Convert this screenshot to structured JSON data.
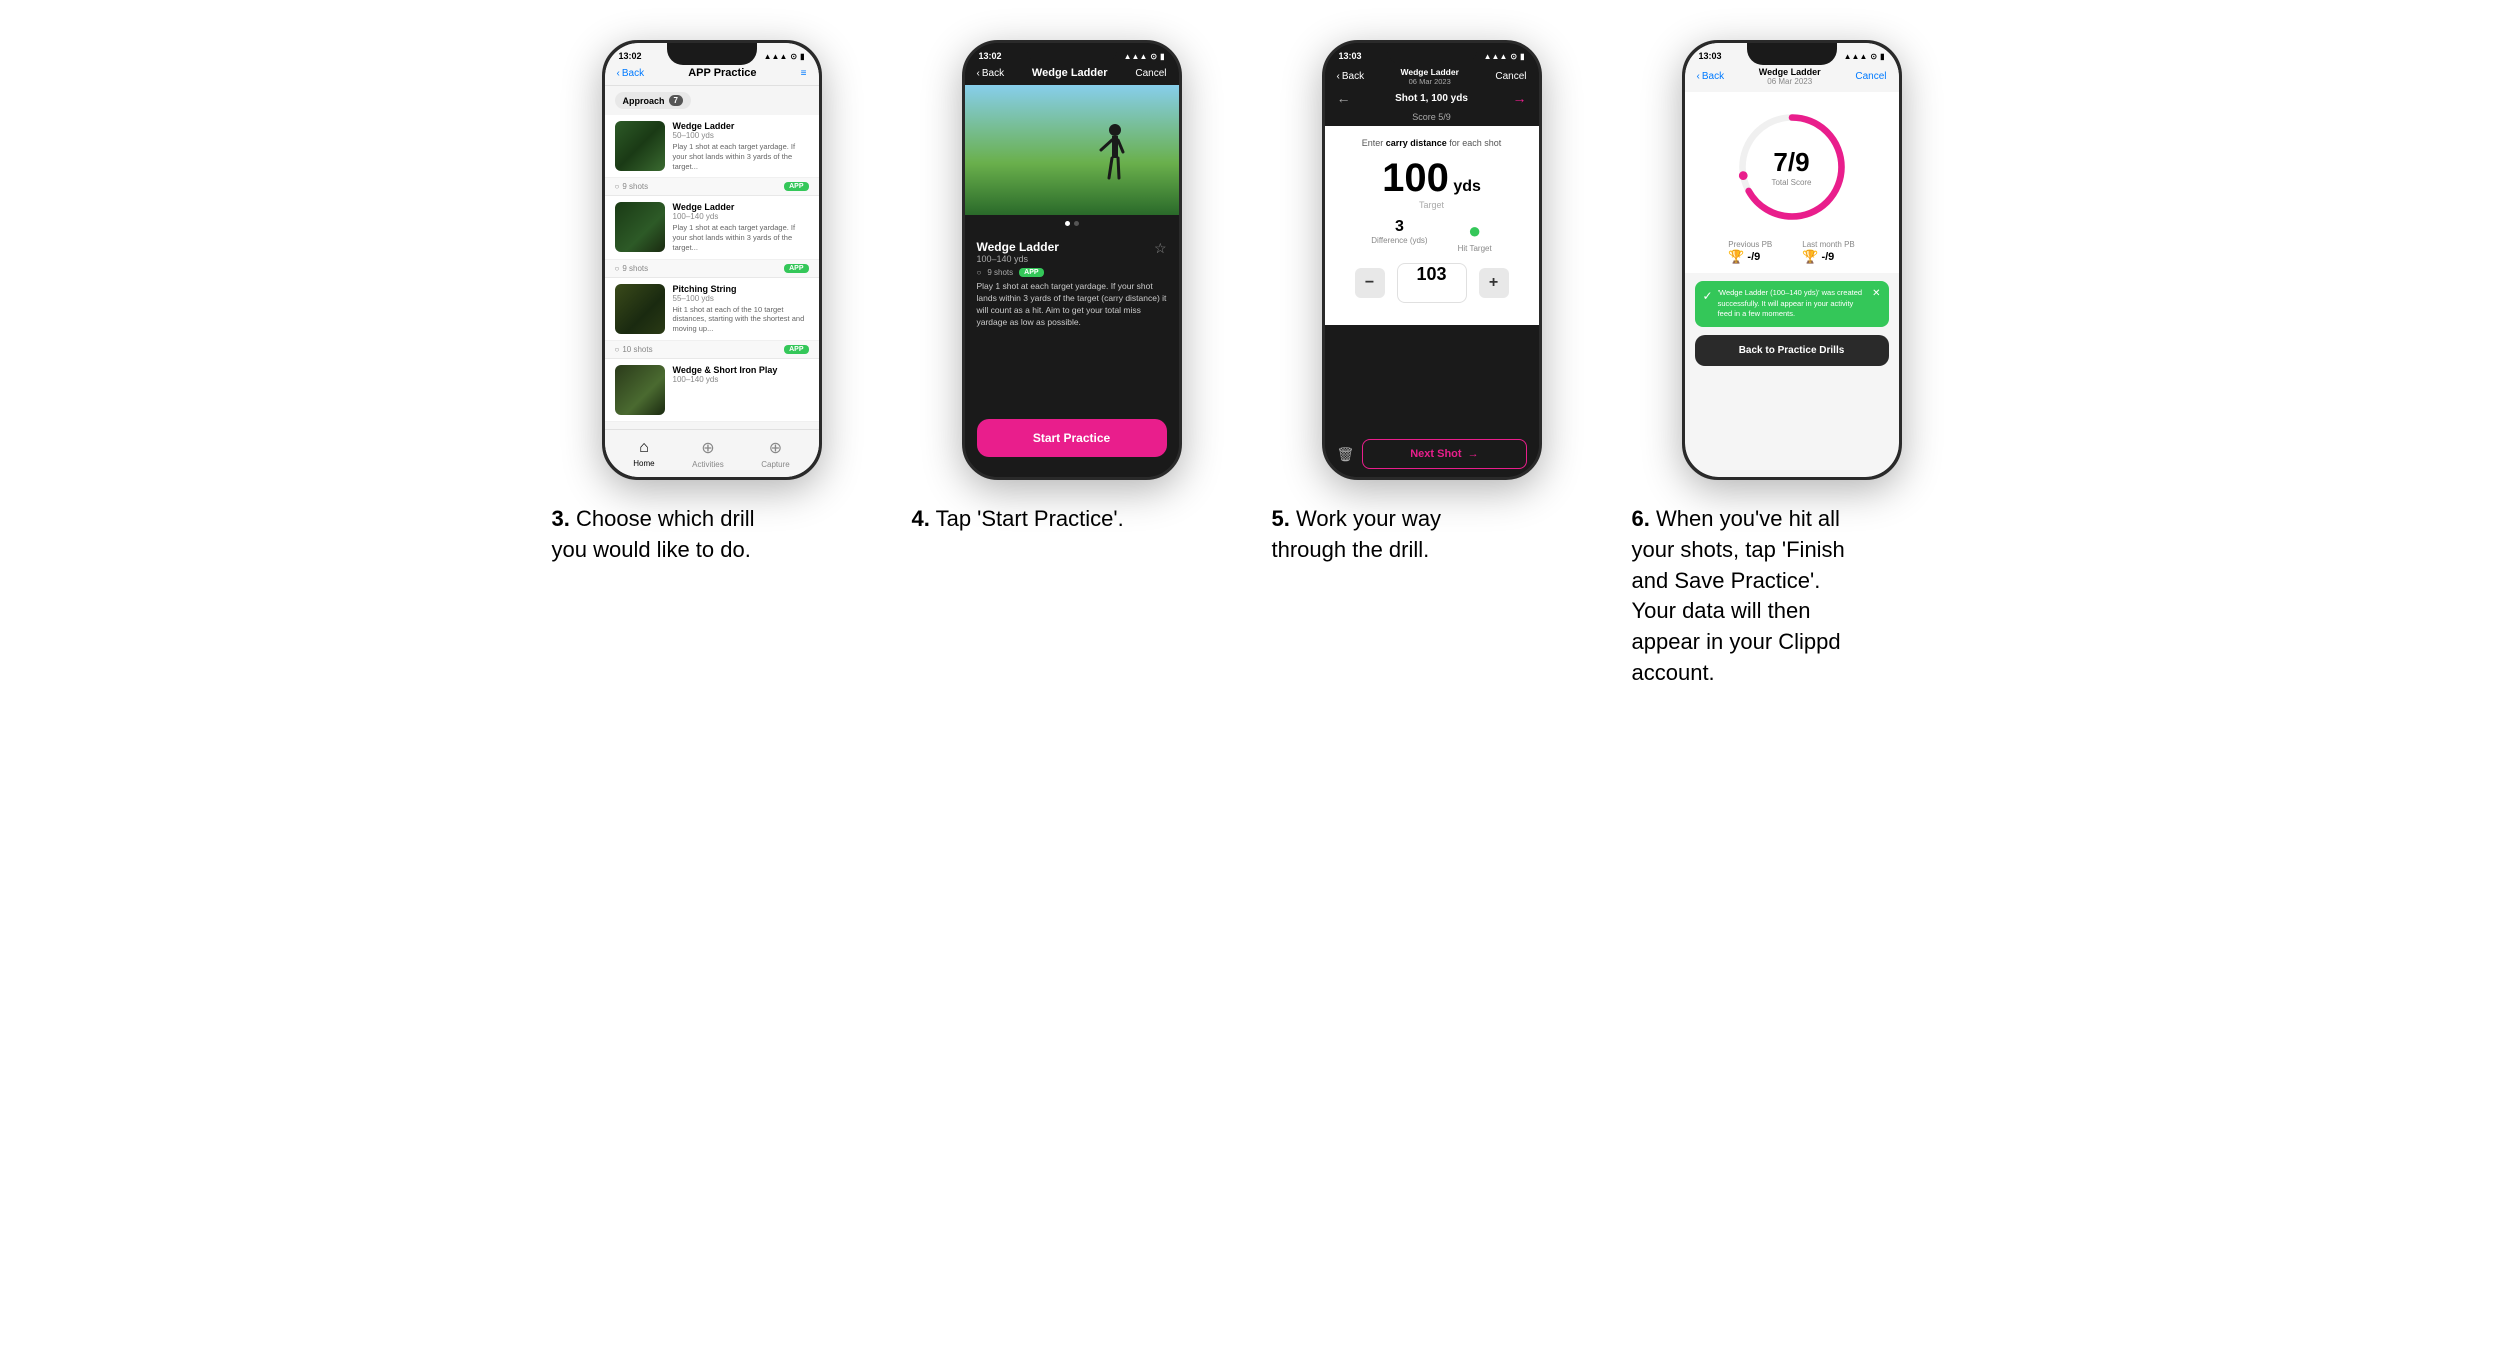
{
  "steps": [
    {
      "number": "3",
      "description": "Choose which drill you would like to do.",
      "phone": {
        "time": "13:02",
        "nav": {
          "back": "Back",
          "title": "APP Practice",
          "action": "≡"
        },
        "category": "Approach",
        "category_count": "7",
        "drills": [
          {
            "name": "Wedge Ladder",
            "range": "50–100 yds",
            "desc": "Play 1 shot at each target yardage. If your shot lands within 3 yards of the target...",
            "shots": "9 shots",
            "badge": "APP"
          },
          {
            "name": "Wedge Ladder",
            "range": "100–140 yds",
            "desc": "Play 1 shot at each target yardage. If your shot lands within 3 yards of the target...",
            "shots": "9 shots",
            "badge": "APP"
          },
          {
            "name": "Pitching String",
            "range": "55–100 yds",
            "desc": "Hit 1 shot at each of the 10 target distances, starting with the shortest and moving up...",
            "shots": "10 shots",
            "badge": "APP"
          },
          {
            "name": "Wedge & Short Iron Play",
            "range": "100–140 yds",
            "desc": "",
            "shots": "",
            "badge": ""
          }
        ],
        "bottom_nav": [
          "Home",
          "Activities",
          "Capture"
        ]
      }
    },
    {
      "number": "4",
      "description": "Tap 'Start Practice'.",
      "phone": {
        "time": "13:02",
        "nav": {
          "back": "Back",
          "title": "Wedge Ladder",
          "action": "Cancel"
        },
        "drill_name": "Wedge Ladder",
        "drill_range": "100–140 yds",
        "drill_shots": "9 shots",
        "drill_badge": "APP",
        "drill_desc": "Play 1 shot at each target yardage. If your shot lands within 3 yards of the target (carry distance) it will count as a hit. Aim to get your total miss yardage as low as possible.",
        "start_btn": "Start Practice"
      }
    },
    {
      "number": "5",
      "description": "Work your way through the drill.",
      "phone": {
        "time": "13:03",
        "nav": {
          "back": "Back",
          "title_line1": "Wedge Ladder",
          "title_line2": "06 Mar 2023",
          "action": "Cancel"
        },
        "shot_label": "Shot 1, 100 yds",
        "shot_score": "Score 5/9",
        "instruction": "Enter carry distance for each shot",
        "target_yards": "100",
        "target_unit": "yds",
        "target_label": "Target",
        "difference": "3",
        "difference_label": "Difference (yds)",
        "hit_target": "●",
        "hit_target_label": "Hit Target",
        "input_value": "103",
        "next_shot": "Next Shot"
      }
    },
    {
      "number": "6",
      "description": "When you've hit all your shots, tap 'Finish and Save Practice'. Your data will then appear in your Clippd account.",
      "phone": {
        "time": "13:03",
        "nav": {
          "back": "Back",
          "title_line1": "Wedge Ladder",
          "title_line2": "06 Mar 2023",
          "action": "Cancel"
        },
        "score": "7",
        "score_total": "9",
        "score_label": "Total Score",
        "previous_pb_label": "Previous PB",
        "previous_pb_value": "-/9",
        "last_month_pb_label": "Last month PB",
        "last_month_pb_value": "-/9",
        "toast_text": "'Wedge Ladder (100–140 yds)' was created successfully. It will appear in your activity feed in a few moments.",
        "back_btn": "Back to Practice Drills"
      }
    }
  ]
}
